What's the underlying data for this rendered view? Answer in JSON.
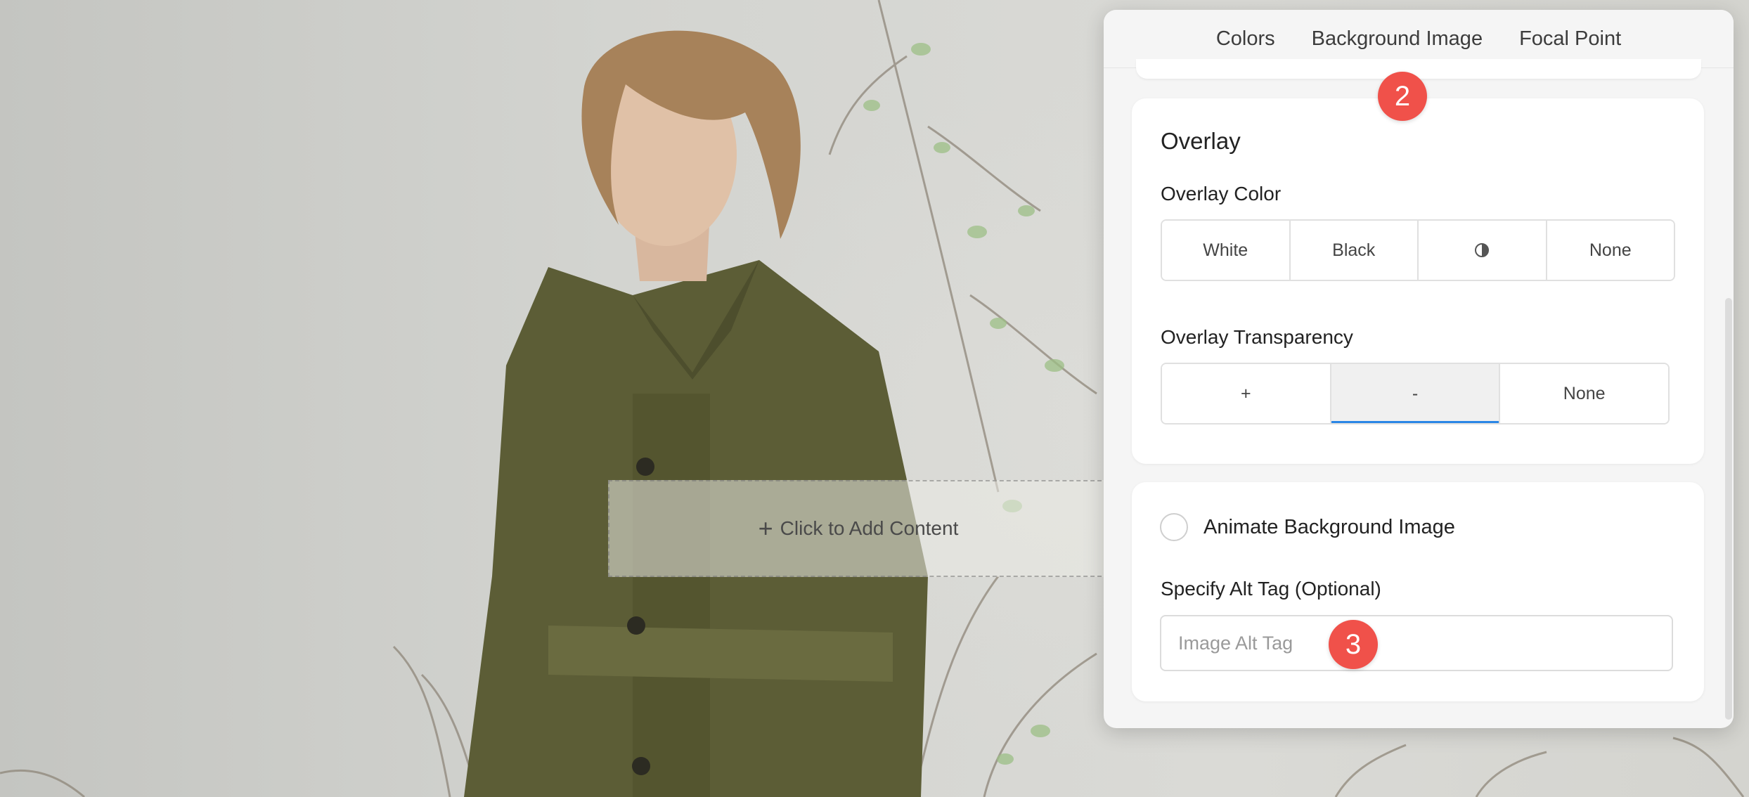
{
  "tabs": [
    {
      "label": "Colors",
      "active": false
    },
    {
      "label": "Background Image",
      "active": true
    },
    {
      "label": "Focal Point",
      "active": false
    }
  ],
  "canvas": {
    "add_content_label": "Click to Add Content"
  },
  "overlay": {
    "title": "Overlay",
    "color_label": "Overlay Color",
    "color_options": [
      "White",
      "Black",
      "",
      "None"
    ],
    "contrast_icon": "contrast-icon",
    "transparency_label": "Overlay Transparency",
    "transparency_options": [
      "+",
      "-",
      "None"
    ],
    "transparency_selected": "-"
  },
  "animate": {
    "radio_label": "Animate Background Image",
    "checked": false
  },
  "alt_tag": {
    "label": "Specify Alt Tag (Optional)",
    "placeholder": "Image Alt Tag",
    "value": ""
  },
  "annotations": {
    "badge_tab": "2",
    "badge_input": "3"
  },
  "colors": {
    "accent": "#2a86e6",
    "badge": "#f0514a"
  }
}
